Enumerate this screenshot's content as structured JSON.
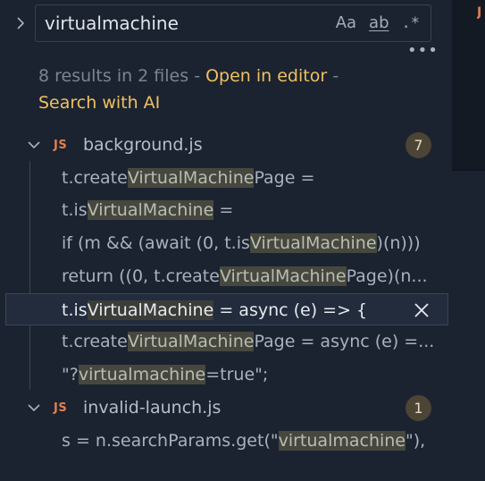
{
  "search": {
    "query": "virtualmachine",
    "match_case_label": "Aa",
    "whole_word_label": "ab",
    "regex_label": ".*"
  },
  "more_label": "•••",
  "summary": {
    "count_text": "8 results in 2 files",
    "sep1": " - ",
    "open_in_editor": "Open in editor",
    "sep2": " -",
    "search_with_ai": "Search with AI"
  },
  "files": [
    {
      "badge": "JS",
      "name": "background.js",
      "count": "7",
      "matches": [
        {
          "before": "t.create",
          "hit": "VirtualMachine",
          "after": "Page ="
        },
        {
          "before": "t.is",
          "hit": "VirtualMachine",
          "after": " ="
        },
        {
          "before": "if (m && (await (0, t.is",
          "hit": "VirtualMachine",
          "after": ")(n)))"
        },
        {
          "before": "return ((0, t.create",
          "hit": "VirtualMachine",
          "after": "Page)(n..."
        },
        {
          "before": "t.is",
          "hit": "VirtualMachine",
          "after": " = async (e) => {"
        },
        {
          "before": "t.create",
          "hit": "VirtualMachine",
          "after": "Page = async (e) =..."
        },
        {
          "before": "\"?",
          "hit": "virtualmachine",
          "after": "=true\";"
        }
      ]
    },
    {
      "badge": "JS",
      "name": "invalid-launch.js",
      "count": "1",
      "matches": [
        {
          "before": "s = n.searchParams.get(\"",
          "hit": "virtualmachine",
          "after": "\"),"
        }
      ]
    }
  ],
  "colors": {
    "background": "#1b2330",
    "link": "#f0c060",
    "js_badge": "#e2804f",
    "count_badge": "#4c4435",
    "highlight": "#46483f"
  },
  "icons": {
    "toggle": "chevron-right-icon",
    "expand": "chevron-down-icon",
    "dismiss": "close-icon",
    "more": "more-icon"
  },
  "edge_glyph": "J"
}
